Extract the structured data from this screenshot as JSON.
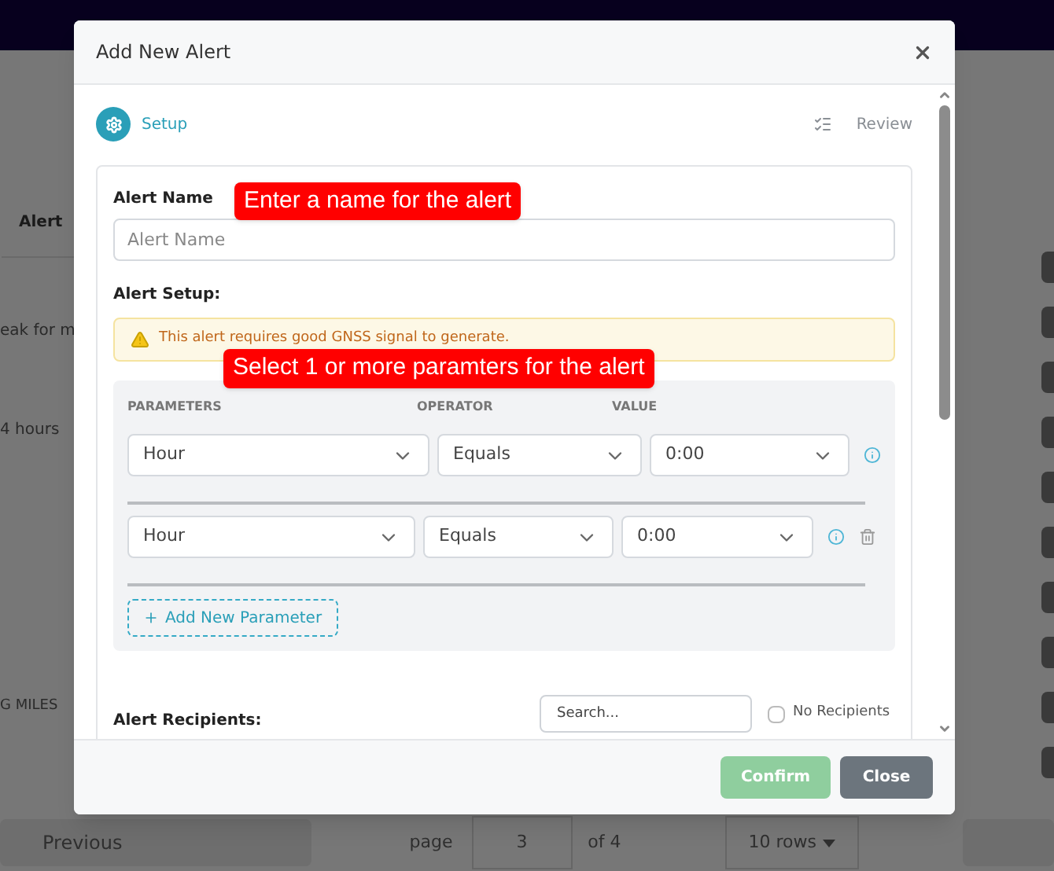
{
  "background": {
    "column_header": "Alert",
    "cells": [
      "eak for m",
      "4 hours",
      "G MILES"
    ],
    "pagination": {
      "previous": "Previous",
      "page_label": "page",
      "page": "3",
      "of": "of 4",
      "rows": "10 rows"
    }
  },
  "dialog": {
    "title": "Add New Alert",
    "steps": [
      {
        "label": "Setup",
        "selected": true
      },
      {
        "label": "Review",
        "selected": false
      }
    ],
    "alert_name": {
      "label": "Alert Name",
      "placeholder": "Alert Name"
    },
    "callouts": [
      "Enter a name for the alert",
      "Select 1 or more paramters for the alert"
    ],
    "alert_setup": {
      "label": "Alert Setup:",
      "warning": "This alert requires good GNSS signal to generate.",
      "columns": [
        "PARAMETERS",
        "OPERATOR",
        "VALUE"
      ],
      "parameters": [
        {
          "parameter": "Hour",
          "operator": "Equals",
          "value": "0:00",
          "removable": false
        },
        {
          "parameter": "Hour",
          "operator": "Equals",
          "value": "0:00",
          "removable": true
        }
      ],
      "add_button": "Add New Parameter"
    },
    "recipients": {
      "label": "Alert Recipients:",
      "search_placeholder": "Search...",
      "no_recipients": {
        "label": "No Recipients",
        "checked": false
      }
    },
    "buttons": [
      {
        "label": "Confirm",
        "kind": "primary",
        "disabled": true
      },
      {
        "label": "Close",
        "kind": "secondary",
        "disabled": false
      }
    ]
  }
}
